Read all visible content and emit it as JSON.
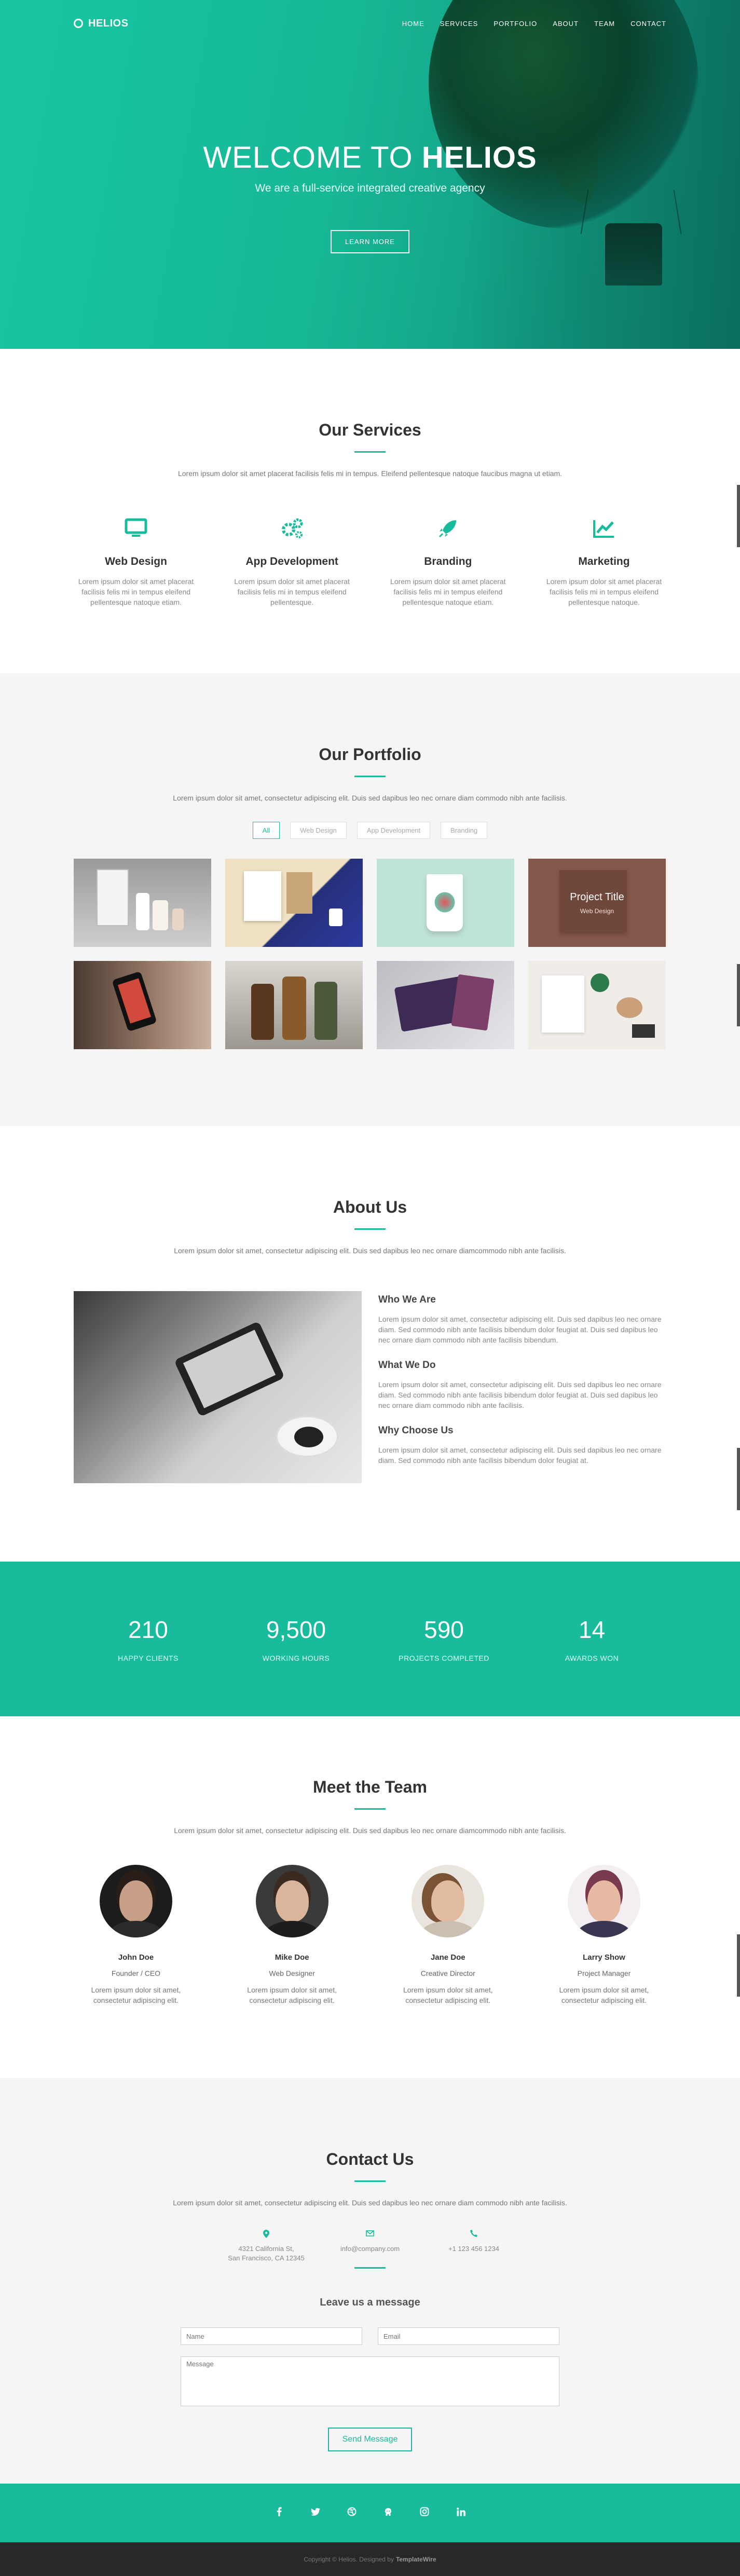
{
  "nav": {
    "brand": "HELIOS",
    "links": [
      "HOME",
      "SERVICES",
      "PORTFOLIO",
      "ABOUT",
      "TEAM",
      "CONTACT"
    ]
  },
  "hero": {
    "title_light": "WELCOME TO",
    "title_bold": "HELIOS",
    "subtitle": "We are a full-service integrated creative agency",
    "button": "LEARN MORE"
  },
  "services": {
    "title": "Our Services",
    "desc": "Lorem ipsum dolor sit amet placerat facilisis felis mi in tempus. Eleifend pellentesque natoque faucibus magna ut etiam.",
    "items": [
      {
        "name": "Web Design",
        "icon": "monitor-icon",
        "text": "Lorem ipsum dolor sit amet placerat facilisis felis mi in tempus eleifend pellentesque natoque etiam."
      },
      {
        "name": "App Development",
        "icon": "gears-icon",
        "text": "Lorem ipsum dolor sit amet placerat facilisis felis mi in tempus eleifend pellentesque."
      },
      {
        "name": "Branding",
        "icon": "rocket-icon",
        "text": "Lorem ipsum dolor sit amet placerat facilisis felis mi in tempus eleifend pellentesque natoque etiam."
      },
      {
        "name": "Marketing",
        "icon": "line-chart-icon",
        "text": "Lorem ipsum dolor sit amet placerat facilisis felis mi in tempus eleifend pellentesque natoque."
      }
    ]
  },
  "portfolio": {
    "title": "Our Portfolio",
    "desc": "Lorem ipsum dolor sit amet, consectetur adipiscing elit. Duis sed dapibus leo nec ornare diam commodo nibh ante facilisis.",
    "filters": [
      "All",
      "Web Design",
      "App Development",
      "Branding"
    ],
    "overlay_title": "Project Title",
    "overlay_category": "Web Design"
  },
  "about": {
    "title": "About Us",
    "desc": "Lorem ipsum dolor sit amet, consectetur adipiscing elit. Duis sed dapibus leo nec ornare diamcommodo nibh ante facilisis.",
    "blocks": [
      {
        "heading": "Who We Are",
        "text": "Lorem ipsum dolor sit amet, consectetur adipiscing elit. Duis sed dapibus leo nec ornare diam. Sed commodo nibh ante facilisis bibendum dolor feugiat at. Duis sed dapibus leo nec ornare diam commodo nibh ante facilisis bibendum."
      },
      {
        "heading": "What We Do",
        "text": "Lorem ipsum dolor sit amet, consectetur adipiscing elit. Duis sed dapibus leo nec ornare diam. Sed commodo nibh ante facilisis bibendum dolor feugiat at. Duis sed dapibus leo nec ornare diam commodo nibh ante facilisis."
      },
      {
        "heading": "Why Choose Us",
        "text": "Lorem ipsum dolor sit amet, consectetur adipiscing elit. Duis sed dapibus leo nec ornare diam. Sed commodo nibh ante facilisis bibendum dolor feugiat at."
      }
    ]
  },
  "stats": [
    {
      "value": "210",
      "label": "HAPPY CLIENTS"
    },
    {
      "value": "9,500",
      "label": "WORKING HOURS"
    },
    {
      "value": "590",
      "label": "PROJECTS COMPLETED"
    },
    {
      "value": "14",
      "label": "AWARDS WON"
    }
  ],
  "team": {
    "title": "Meet the Team",
    "desc": "Lorem ipsum dolor sit amet, consectetur adipiscing elit. Duis sed dapibus leo nec ornare diamcommodo nibh ante facilisis.",
    "members": [
      {
        "name": "John Doe",
        "role": "Founder / CEO",
        "text": "Lorem ipsum dolor sit amet, consectetur adipiscing elit."
      },
      {
        "name": "Mike Doe",
        "role": "Web Designer",
        "text": "Lorem ipsum dolor sit amet, consectetur adipiscing elit."
      },
      {
        "name": "Jane Doe",
        "role": "Creative Director",
        "text": "Lorem ipsum dolor sit amet, consectetur adipiscing elit."
      },
      {
        "name": "Larry Show",
        "role": "Project Manager",
        "text": "Lorem ipsum dolor sit amet, consectetur adipiscing elit."
      }
    ]
  },
  "contact": {
    "title": "Contact Us",
    "desc": "Lorem ipsum dolor sit amet, consectetur adipiscing elit. Duis sed dapibus leo nec ornare diam commodo nibh ante facilisis.",
    "address_line1": "4321 California St,",
    "address_line2": "San Francisco, CA 12345",
    "email": "info@company.com",
    "phone": "+1 123 456 1234",
    "form_title": "Leave us a message",
    "name_placeholder": "Name",
    "email_placeholder": "Email",
    "message_placeholder": "Message",
    "send_button": "Send Message"
  },
  "social_icons": [
    "facebook-icon",
    "twitter-icon",
    "dribbble-icon",
    "github-icon",
    "instagram-icon",
    "linkedin-icon"
  ],
  "footer": {
    "copyright": "Copyright © Helios. Designed by",
    "designer": "TemplateWire"
  },
  "colors": {
    "accent": "#18bc9c",
    "footer_bg": "#282828",
    "section_alt": "#f5f5f5"
  }
}
